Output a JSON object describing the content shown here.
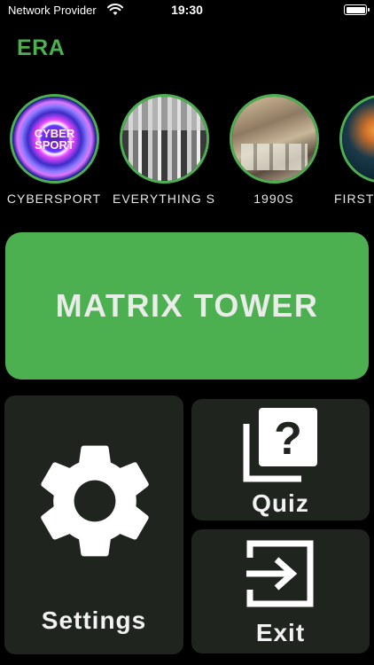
{
  "status_bar": {
    "carrier": "Network Provider",
    "time": "19:30"
  },
  "header": {
    "title": "ERA",
    "accent_color": "#4caf50"
  },
  "stories": [
    {
      "label": "CYBERSPORT",
      "image_text": "CYBER SPORT"
    },
    {
      "label": "EVERYTHING S"
    },
    {
      "label": "1990S"
    },
    {
      "label": "FIRST"
    }
  ],
  "main": {
    "primary_button": "MATRIX TOWER",
    "settings_label": "Settings",
    "quiz_label": "Quiz",
    "exit_label": "Exit"
  },
  "icons": {
    "settings": "gear-icon",
    "quiz": "question-stack-icon",
    "exit": "exit-arrow-icon",
    "status_wifi": "wifi-icon",
    "status_battery": "battery-icon"
  }
}
